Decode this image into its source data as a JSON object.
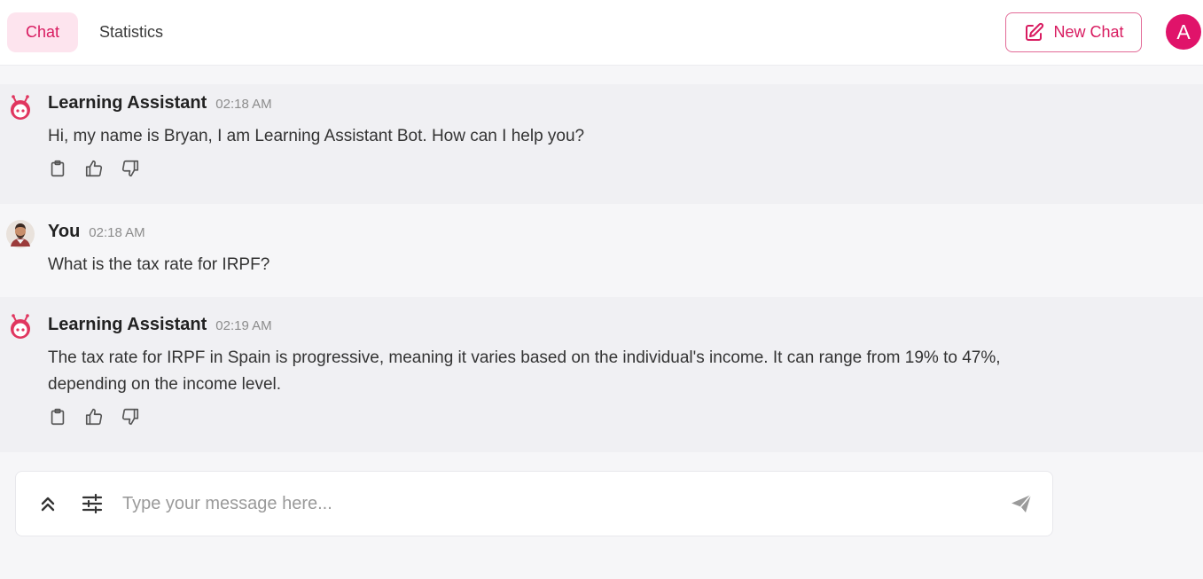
{
  "tabs": [
    {
      "label": "Chat",
      "active": true
    },
    {
      "label": "Statistics",
      "active": false
    }
  ],
  "header": {
    "new_chat_label": "New Chat",
    "account_initial": "A",
    "accent_color": "#d81b60"
  },
  "messages": [
    {
      "sender": "Learning Assistant",
      "time": "02:18 AM",
      "text": "Hi, my name is Bryan, I am Learning Assistant Bot. How can I help you?",
      "role": "bot",
      "icons": [
        "robot-icon",
        "copy-icon",
        "thumbs-up-icon",
        "thumbs-down-icon"
      ]
    },
    {
      "sender": "You",
      "time": "02:18 AM",
      "text": "What is the tax rate for IRPF?",
      "role": "user",
      "icons": [
        "user-avatar"
      ]
    },
    {
      "sender": "Learning Assistant",
      "time": "02:19 AM",
      "text": "The tax rate for IRPF in Spain is progressive, meaning it varies based on the individual's income. It can range from 19% to 47%, depending on the income level.",
      "role": "bot",
      "icons": [
        "robot-icon",
        "copy-icon",
        "thumbs-up-icon",
        "thumbs-down-icon"
      ]
    }
  ],
  "composer": {
    "placeholder": "Type your message here...",
    "value": "",
    "icons": [
      "double-chevron-up-icon",
      "sliders-icon",
      "send-icon"
    ]
  }
}
